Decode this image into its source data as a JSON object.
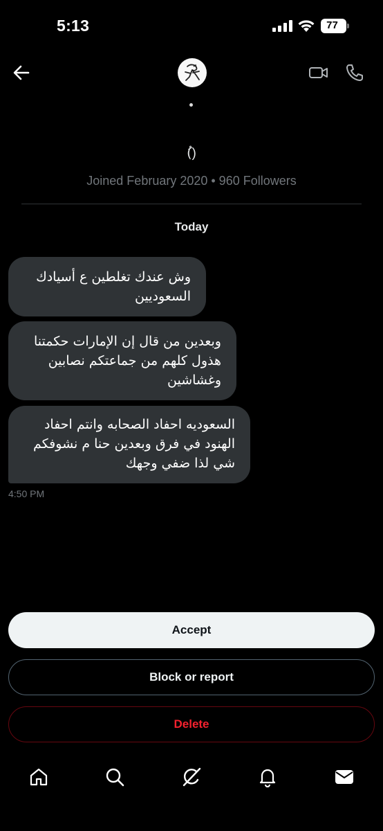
{
  "status_bar": {
    "time": "5:13",
    "battery": "77",
    "icons": [
      "cellular-signal-icon",
      "wifi-icon",
      "battery-icon"
    ]
  },
  "header": {
    "icons": [
      "back-arrow-icon",
      "video-call-icon",
      "phone-call-icon"
    ]
  },
  "profile": {
    "name": "(ُ)",
    "meta": "Joined February 2020 • 960 Followers"
  },
  "conversation": {
    "day_label": "Today",
    "messages": [
      {
        "text": "وش عندك تغلطين ع أسيادك السعوديين"
      },
      {
        "text": "وبعدين من قال إن الإمارات حكمتنا هذول كلهم من جماعتكم نصابين وغشاشين"
      },
      {
        "text": "السعوديه احفاد الصحابه وانتم احفاد الهنود في فرق وبعدين حنا م نشوفكم شي لذا ضفي وجهك"
      }
    ],
    "timestamp": "4:50 PM"
  },
  "actions": {
    "accept": "Accept",
    "block_or_report": "Block or report",
    "delete": "Delete"
  },
  "tabbar": {
    "icons": [
      "home-icon",
      "search-icon",
      "grok-icon",
      "notifications-bell-icon",
      "messages-envelope-icon"
    ]
  },
  "colors": {
    "background": "#000000",
    "bubble": "#2f3336",
    "muted_text": "#71767b",
    "accept_bg": "#eff3f4",
    "delete_red": "#f4212e"
  }
}
